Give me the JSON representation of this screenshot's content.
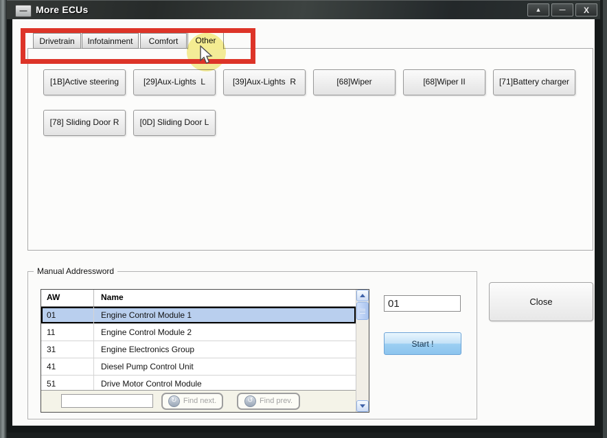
{
  "titlebar": {
    "title": "More ECUs",
    "restore_glyph": "—",
    "maximize_glyph": "▲",
    "minimize_glyph": "—",
    "close_glyph": "X"
  },
  "tabs": [
    {
      "label": "Drivetrain",
      "active": false
    },
    {
      "label": "Infotainment",
      "active": false
    },
    {
      "label": "Comfort",
      "active": false
    },
    {
      "label": "Other",
      "active": true
    }
  ],
  "ecu_buttons": [
    "[1B]Active steering",
    "[29]Aux-Lights  L",
    "[39]Aux-Lights  R",
    "[68]Wiper",
    "[68]Wiper II",
    "[71]Battery charger",
    "[78] Sliding Door R",
    "[0D] Sliding Door L"
  ],
  "manual_addressword": {
    "legend": "Manual Addressword",
    "table": {
      "columns": [
        "AW",
        "Name"
      ],
      "rows": [
        {
          "aw": "01",
          "name": "Engine Control Module 1",
          "selected": true
        },
        {
          "aw": "11",
          "name": "Engine Control Module 2",
          "selected": false
        },
        {
          "aw": "31",
          "name": "Engine Electronics Group",
          "selected": false
        },
        {
          "aw": "41",
          "name": "Diesel Pump Control Unit",
          "selected": false
        },
        {
          "aw": "51",
          "name": "Drive Motor Control Module",
          "selected": false
        }
      ]
    },
    "find_input_value": "",
    "find_next_label": "Find next.",
    "find_next_icon_glyph": "↻",
    "find_prev_label": "Find prev.",
    "find_prev_icon_glyph": "↺",
    "address_value": "01",
    "start_label": "Start !"
  },
  "close_label": "Close",
  "annotations": {
    "highlighted_tab": "Other",
    "red_box_color": "#dd3428",
    "highlight_yellow": "#f0e45a"
  },
  "colors": {
    "selection_blue": "#b9cfee",
    "start_button_blue": "#8cc4ee",
    "titlebar_dark": "#2b302f"
  }
}
